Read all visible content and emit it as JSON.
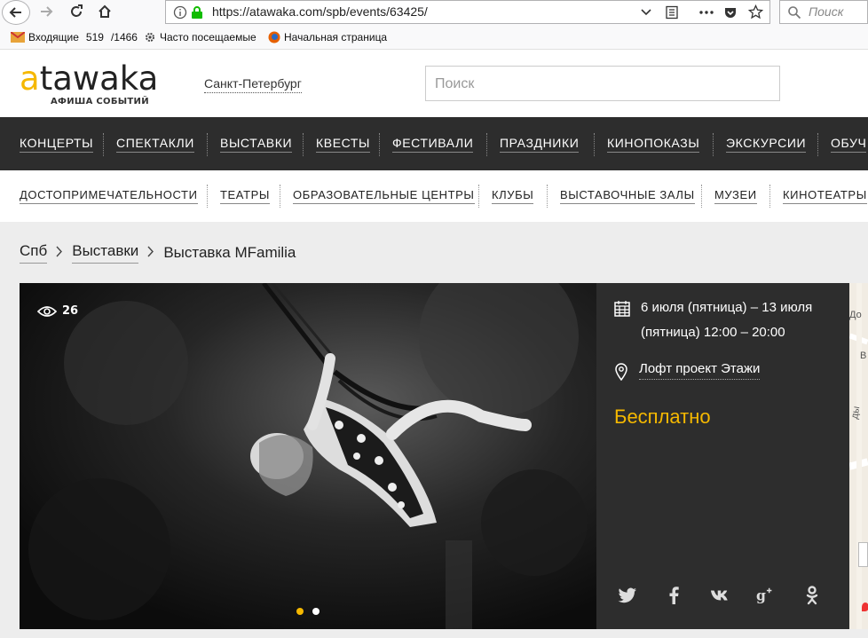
{
  "browser": {
    "url": "https://atawaka.com/spb/events/63425/",
    "search_placeholder": "Поиск",
    "bookmarks": {
      "inbox_label": "Входящие",
      "inbox_count": "519",
      "inbox_total": "/1466",
      "most_visited": "Часто посещаемые",
      "home_page": "Начальная страница"
    }
  },
  "header": {
    "logo_text": "atawaka",
    "logo_sub": "АФИША СОБЫТИЙ",
    "city": "Санкт-Петербург",
    "search_placeholder": "Поиск"
  },
  "main_nav": [
    "КОНЦЕРТЫ",
    "СПЕКТАКЛИ",
    "ВЫСТАВКИ",
    "КВЕСТЫ",
    "ФЕСТИВАЛИ",
    "ПРАЗДНИКИ",
    "КИНОПОКАЗЫ",
    "ЭКСКУРСИИ",
    "ОБУЧ"
  ],
  "sub_nav": [
    "ДОСТОПРИМЕЧАТЕЛЬНОСТИ",
    "ТЕАТРЫ",
    "ОБРАЗОВАТЕЛЬНЫЕ ЦЕНТРЫ",
    "КЛУБЫ",
    "ВЫСТАВОЧНЫЕ ЗАЛЫ",
    "МУЗЕИ",
    "КИНОТЕАТРЫ"
  ],
  "breadcrumbs": {
    "home": "Спб",
    "section": "Выставки",
    "current": "Выставка MFamilia"
  },
  "event": {
    "views": "26",
    "date_line1": "6 июля (пятница) – 13 июля",
    "date_line2": "(пятница) 12:00 – 20:00",
    "place": "Лофт проект Этажи",
    "price": "Бесплатно",
    "slides_total": 2,
    "slide_active": 1
  },
  "map": {
    "fragments": [
      "До",
      "В",
      "ды"
    ]
  },
  "colors": {
    "accent": "#f5b800",
    "nav_dark": "#2d2d2d",
    "content_bg": "#ededed"
  }
}
